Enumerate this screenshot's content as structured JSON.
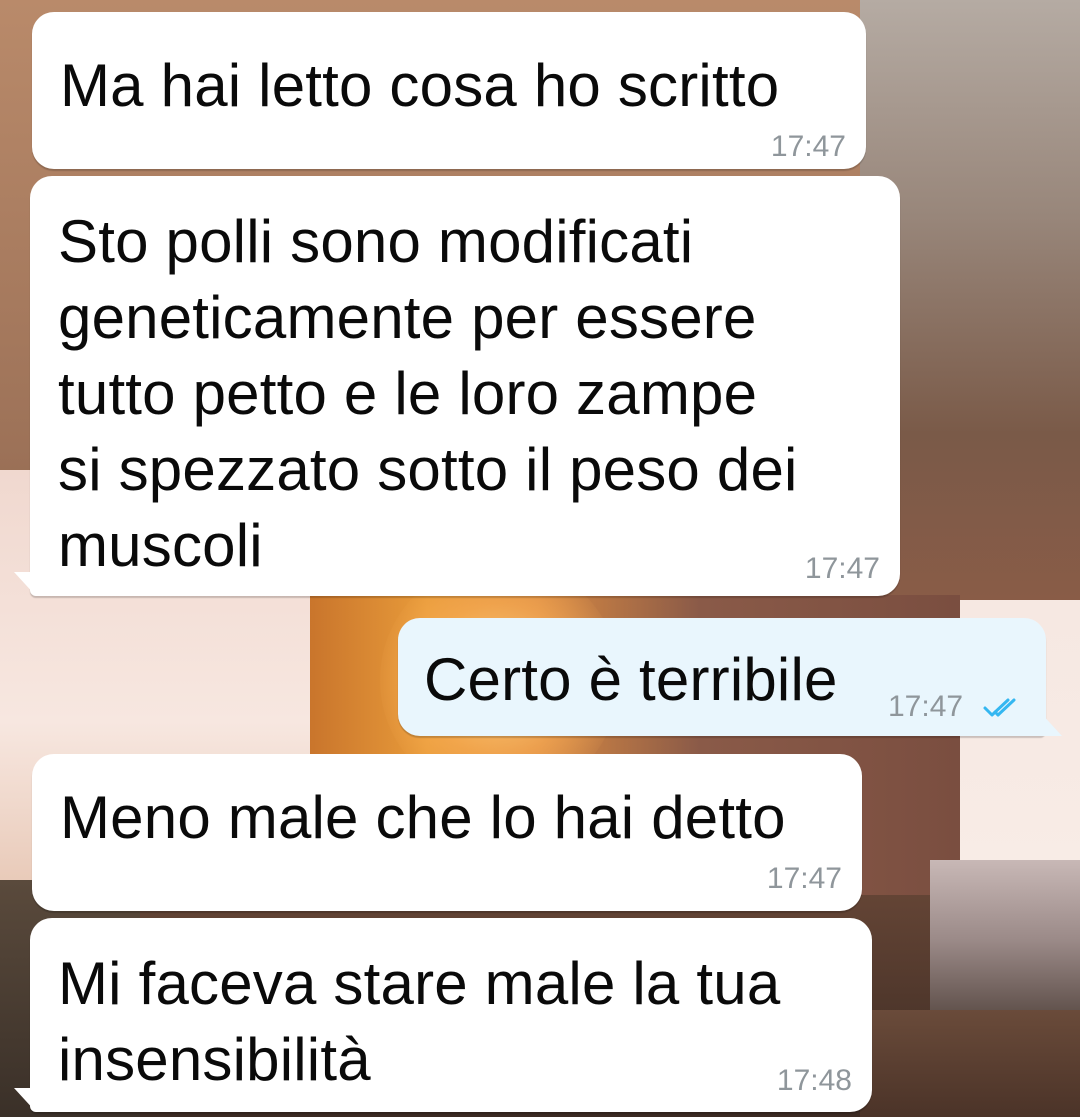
{
  "chat": {
    "messages": [
      {
        "direction": "in",
        "text": "Ma hai letto cosa ho scritto",
        "time": "17:47"
      },
      {
        "direction": "in",
        "text": "Sto polli sono modificati\ngeneticamente per essere\ntutto petto e le loro zampe\nsi spezzato sotto il peso dei\nmuscoli",
        "time": "17:47"
      },
      {
        "direction": "out",
        "text": "Certo è terribile",
        "time": "17:47",
        "status_icon": "double-check-read-icon",
        "status_color": "#34b7f1"
      },
      {
        "direction": "in",
        "text": "Meno male che lo hai detto",
        "time": "17:47"
      },
      {
        "direction": "in",
        "text": "Mi faceva stare male la tua\ninsensibilità",
        "time": "17:48"
      }
    ]
  },
  "colors": {
    "incoming_bubble": "#ffffff",
    "outgoing_bubble": "#e9f6fd",
    "timestamp": "#8f969b"
  }
}
